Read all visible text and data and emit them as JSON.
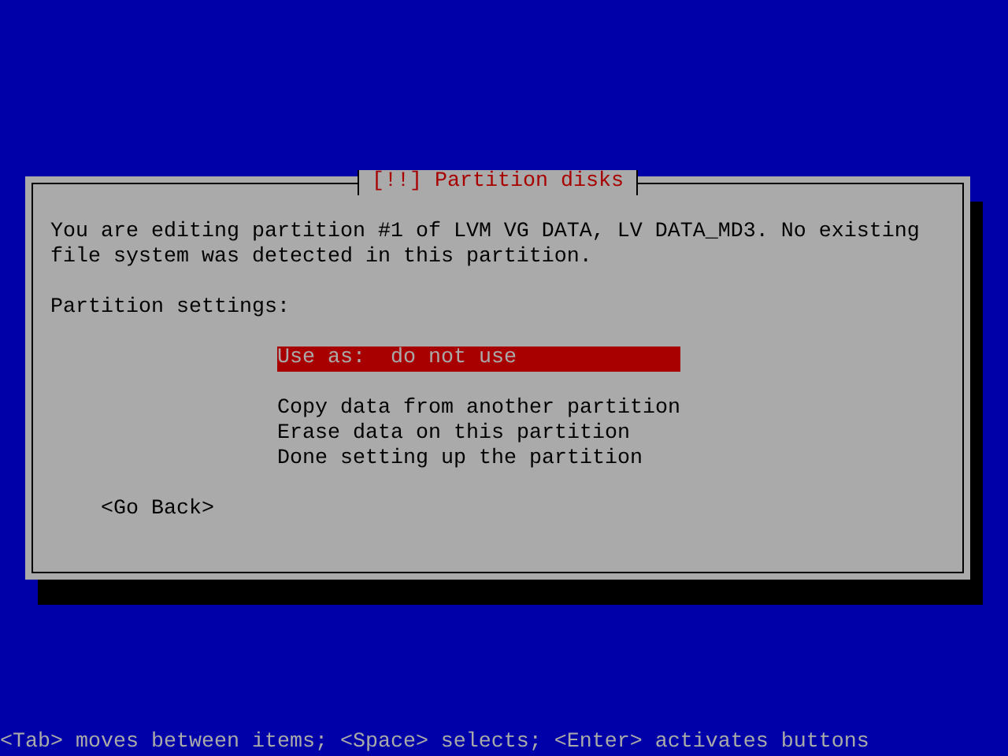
{
  "dialog": {
    "title": "[!!] Partition disks",
    "message": "You are editing partition #1 of LVM VG DATA, LV DATA_MD3. No existing file system was detected in this partition.",
    "settings_label": "Partition settings:",
    "option_groups": [
      {
        "options": [
          {
            "label": "Use as:  do not use",
            "selected": true
          }
        ]
      },
      {
        "options": [
          {
            "label": "Copy data from another partition",
            "selected": false
          },
          {
            "label": "Erase data on this partition",
            "selected": false
          },
          {
            "label": "Done setting up the partition",
            "selected": false
          }
        ]
      }
    ],
    "back_button": "<Go Back>"
  },
  "status_bar": "<Tab> moves between items; <Space> selects; <Enter> activates buttons"
}
